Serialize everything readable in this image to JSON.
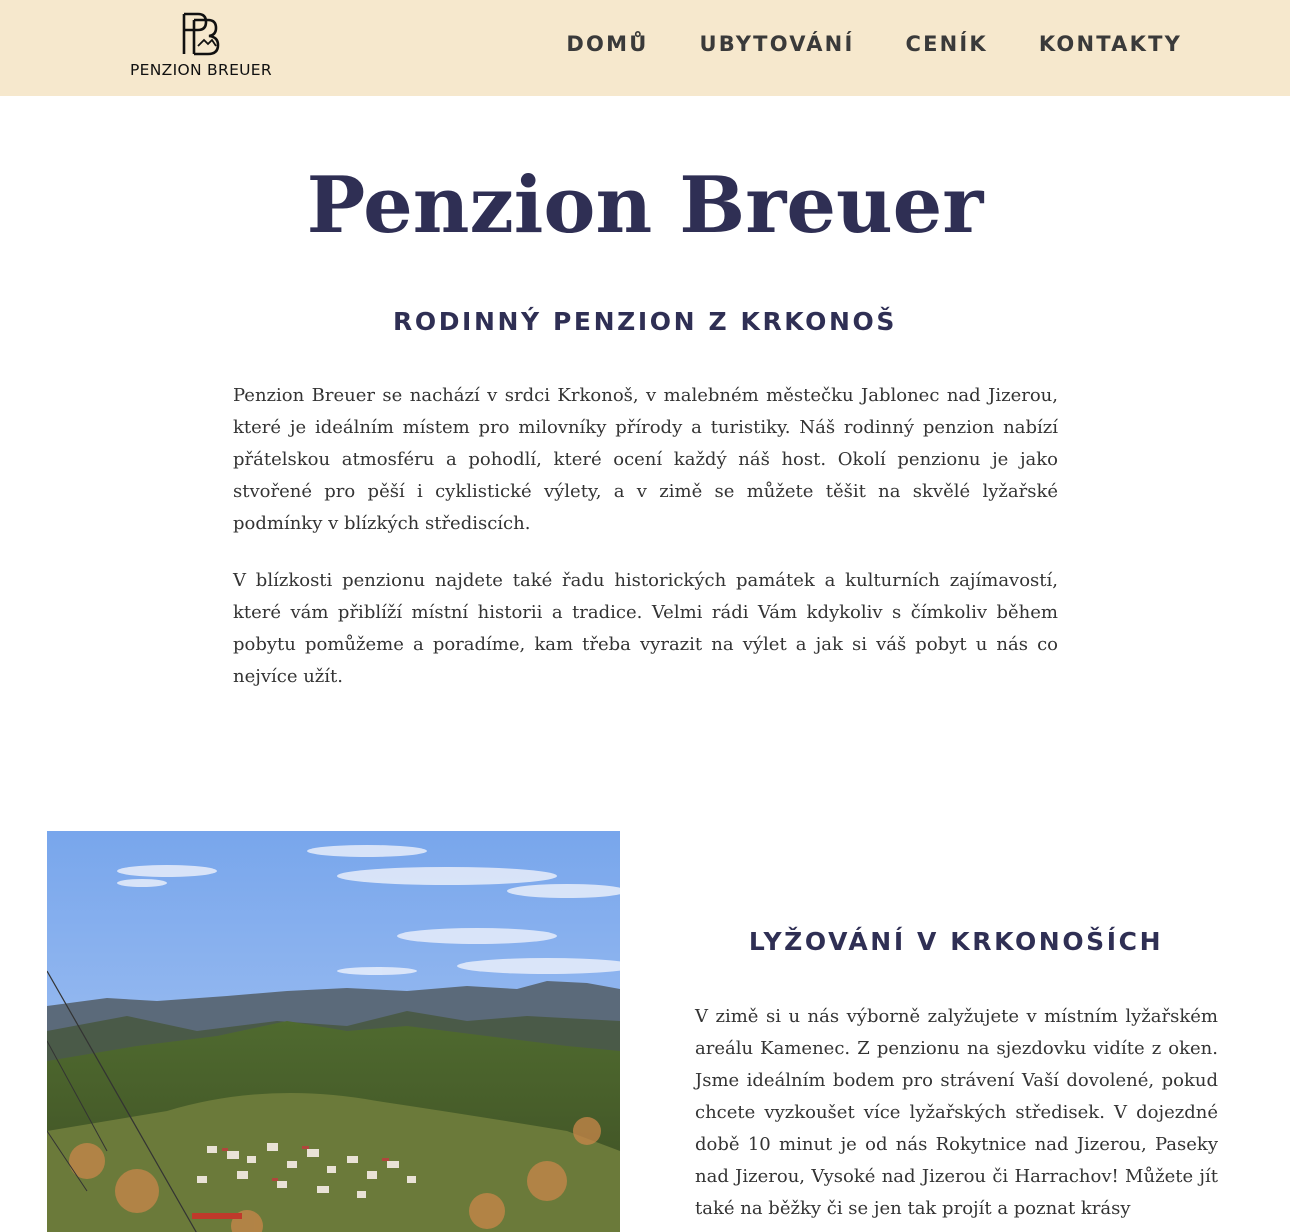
{
  "header": {
    "logo_text": "PENZION BREUER",
    "nav": [
      "DOMŮ",
      "UBYTOVÁNÍ",
      "CENÍK",
      "KONTAKTY"
    ]
  },
  "intro": {
    "title": "Penzion Breuer",
    "subtitle": "RODINNÝ PENZION Z KRKONOŠ",
    "paragraphs": [
      "Penzion Breuer se nachází v srdci Krkonoš, v malebném městečku Jablonec nad Jizerou, které je ideálním místem pro milovníky přírody a turistiky. Náš rodinný penzion nabízí přátelskou atmosféru a pohodlí, které ocení každý náš host. Okolí penzionu je jako stvořené pro pěší i cyklistické výlety, a v zimě se můžete těšit na skvělé lyžařské podmínky v blízkých střediscích.",
      "V blízkosti penzionu najdete také řadu historických památek a kulturních zajímavostí, které vám přiblíží místní historii a tradice. Velmi rádi Vám kdykoliv s čímkoliv během pobytu pomůžeme a poradíme, kam třeba vyrazit na výlet a jak si váš pobyt u nás co nejvíce užít."
    ]
  },
  "ski": {
    "title": "LYŽOVÁNÍ V KRKONOŠÍCH",
    "text": "V zimě si u nás výborně zalyžujete v místním lyžařském areálu Kamenec. Z penzionu na sjezdovku vidíte z oken. Jsme ideálním bodem pro strávení Vaší dovolené, pokud chcete vyzkoušet více lyžařských středisek. V dojezdné době 10 minut je od nás Rokytnice nad Jizerou, Paseky nad Jizerou, Vysoké nad Jizerou či Harrachov! Můžete jít také na běžky či se jen tak projít a poznat krásy"
  },
  "colors": {
    "header_bg": "#f6e8cd",
    "heading": "#2f2f54"
  }
}
